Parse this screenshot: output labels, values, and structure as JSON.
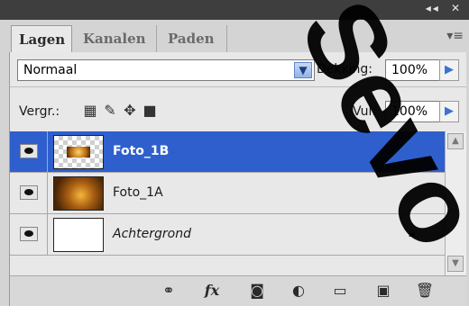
{
  "titlebar": {
    "collapse": "◂◂",
    "close": "✕"
  },
  "tabs": [
    {
      "label": "Lagen"
    },
    {
      "label": "Kanalen"
    },
    {
      "label": "Paden"
    }
  ],
  "panel_menu": "▾≡",
  "blend_mode": {
    "value": "Normaal"
  },
  "opacity": {
    "label": "Dekking:",
    "value": "100%"
  },
  "lock": {
    "label": "Vergr.:"
  },
  "fill": {
    "label": "Vul:",
    "value": "100%"
  },
  "layers": [
    {
      "name": "Foto_1B",
      "selected": true,
      "italic": false,
      "locked": false
    },
    {
      "name": "Foto_1A",
      "selected": false,
      "italic": false,
      "locked": false
    },
    {
      "name": "Achtergrond",
      "selected": false,
      "italic": true,
      "locked": true
    }
  ],
  "bottom_icons": [
    "link-icon",
    "fx-icon",
    "mask-icon",
    "adjustment-icon",
    "group-folder-icon",
    "new-layer-icon",
    "trash-icon"
  ],
  "colors": {
    "selection": "#2e5fcd",
    "panel": "#d4d4d4",
    "titlebar": "#3e3e3e"
  },
  "watermark": "Sevo"
}
